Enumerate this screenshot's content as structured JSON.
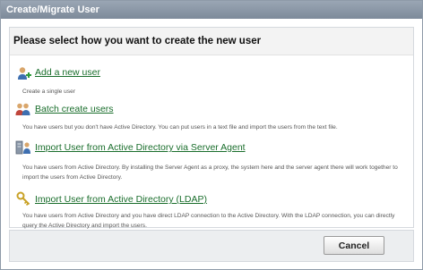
{
  "window": {
    "title": "Create/Migrate User"
  },
  "main": {
    "heading": "Please select how you want to create the new user",
    "options": [
      {
        "label": "Add a new user",
        "icon": "user-add-icon",
        "description": "Create a single user"
      },
      {
        "label": "Batch create users",
        "icon": "users-batch-icon",
        "description": "You have users but you don't have Active Directory. You can put users in a text file and import the users from the text file."
      },
      {
        "label": "Import User from Active Directory via Server Agent",
        "icon": "server-agent-icon",
        "description": "You have users from Active Directory. By installing the Server Agent as a proxy, the system here and the server agent there will work together to import the users from Active Directory."
      },
      {
        "label": "Import User from Active Directory (LDAP)",
        "icon": "ldap-key-icon",
        "description": "You have users from Active Directory and you have direct LDAP connection to the Active Directory. With the LDAP connection, you can directly query the Active Directory and import the users."
      }
    ]
  },
  "footer": {
    "cancel_label": "Cancel"
  }
}
